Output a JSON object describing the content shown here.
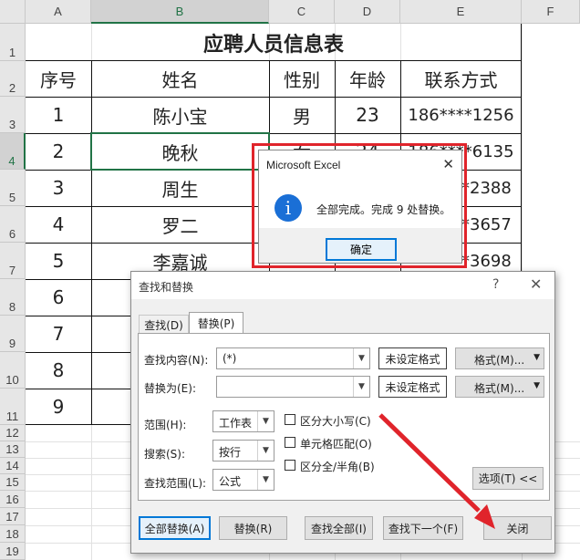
{
  "columns": [
    "A",
    "B",
    "C",
    "D",
    "E",
    "F"
  ],
  "rows": [
    "1",
    "2",
    "3",
    "4",
    "5",
    "6",
    "7",
    "8",
    "9",
    "10",
    "11",
    "12",
    "13",
    "14",
    "15",
    "16",
    "17",
    "18",
    "19"
  ],
  "table": {
    "title": "应聘人员信息表",
    "headers": [
      "序号",
      "姓名",
      "性别",
      "年龄",
      "联系方式"
    ],
    "rows": [
      [
        "1",
        "陈小宝",
        "男",
        "23",
        "186****1256"
      ],
      [
        "2",
        "晚秋",
        "女",
        "24",
        "186****6135"
      ],
      [
        "3",
        "周生",
        "",
        "",
        "*2388"
      ],
      [
        "4",
        "罗二",
        "",
        "",
        "*3657"
      ],
      [
        "5",
        "李嘉诚",
        "",
        "",
        "*3698"
      ],
      [
        "6",
        "",
        "",
        "",
        ""
      ],
      [
        "7",
        "",
        "",
        "",
        ""
      ],
      [
        "8",
        "",
        "",
        "",
        ""
      ],
      [
        "9",
        "",
        "",
        "",
        ""
      ]
    ]
  },
  "message_box": {
    "title": "Microsoft Excel",
    "close": "✕",
    "icon": "info-icon",
    "icon_glyph": "i",
    "message": "全部完成。完成 9 处替换。",
    "ok": "确定"
  },
  "find_replace": {
    "title": "查找和替换",
    "help": "?",
    "close": "✕",
    "tabs": [
      "查找(D)",
      "替换(P)"
    ],
    "active_tab": "替换(P)",
    "find_label": "查找内容(N):",
    "find_value": "(*)",
    "replace_label": "替换为(E):",
    "replace_value": "",
    "no_format": "未设定格式",
    "format": "格式(M)...",
    "within_label": "范围(H):",
    "within_value": "工作表",
    "search_label": "搜索(S):",
    "search_value": "按行",
    "lookin_label": "查找范围(L):",
    "lookin_value": "公式",
    "options": {
      "match_case": "区分大小写(C)",
      "entire_cell": "单元格匹配(O)",
      "byte_width": "区分全/半角(B)"
    },
    "options_button": "选项(T) <<",
    "buttons": {
      "replace_all": "全部替换(A)",
      "replace": "替换(R)",
      "find_all": "查找全部(I)",
      "find_next": "查找下一个(F)",
      "close": "关闭"
    }
  },
  "annotation_color": "#e0242b"
}
